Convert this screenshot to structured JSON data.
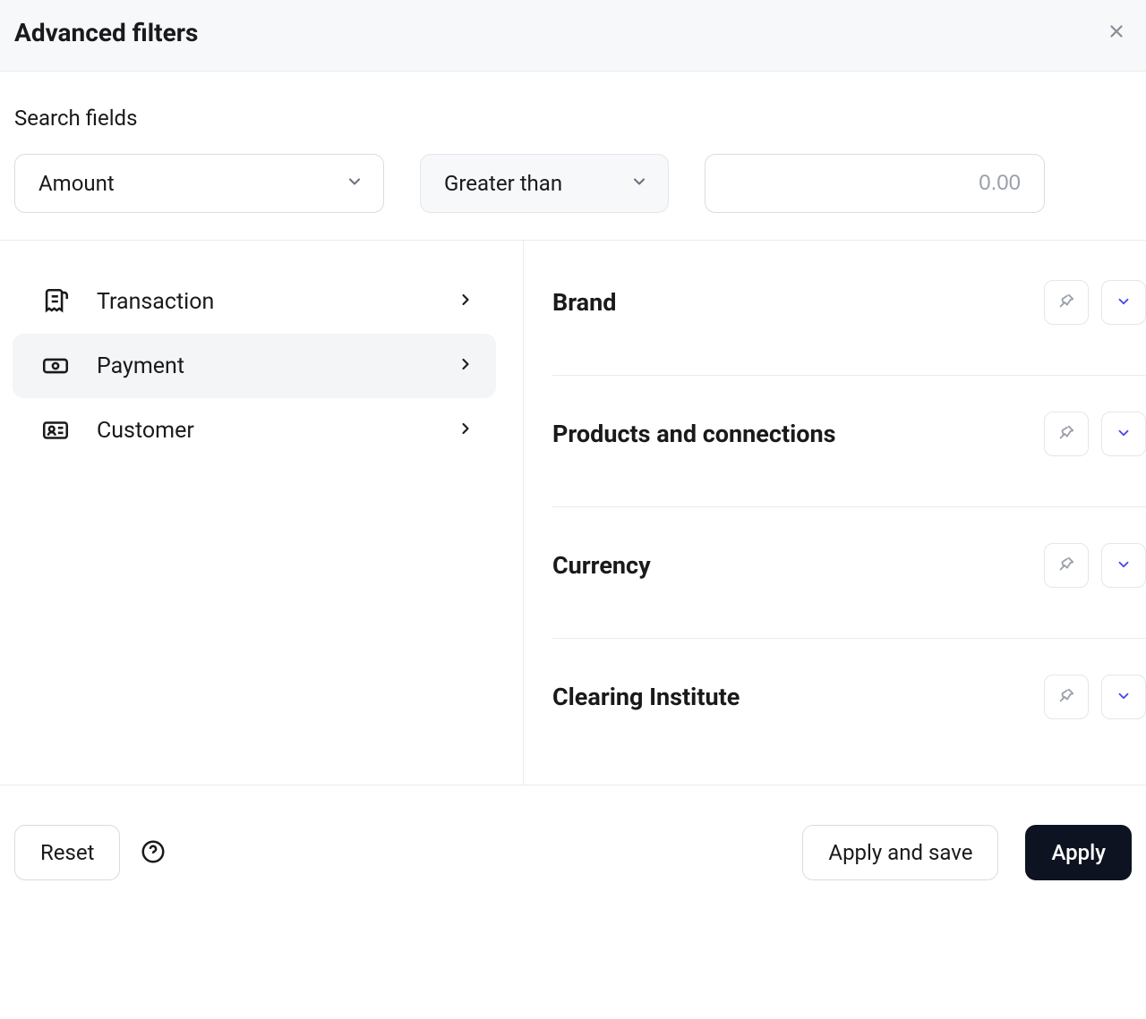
{
  "header": {
    "title": "Advanced filters"
  },
  "search": {
    "label": "Search fields",
    "field_selected": "Amount",
    "operator_selected": "Greater than",
    "value_placeholder": "0.00"
  },
  "categories": [
    {
      "id": "transaction",
      "label": "Transaction",
      "active": false
    },
    {
      "id": "payment",
      "label": "Payment",
      "active": true
    },
    {
      "id": "customer",
      "label": "Customer",
      "active": false
    }
  ],
  "filters": [
    {
      "id": "brand",
      "title": "Brand"
    },
    {
      "id": "products",
      "title": "Products and connections"
    },
    {
      "id": "currency",
      "title": "Currency"
    },
    {
      "id": "clearing",
      "title": "Clearing Institute"
    }
  ],
  "footer": {
    "reset": "Reset",
    "apply_save": "Apply and save",
    "apply": "Apply"
  }
}
